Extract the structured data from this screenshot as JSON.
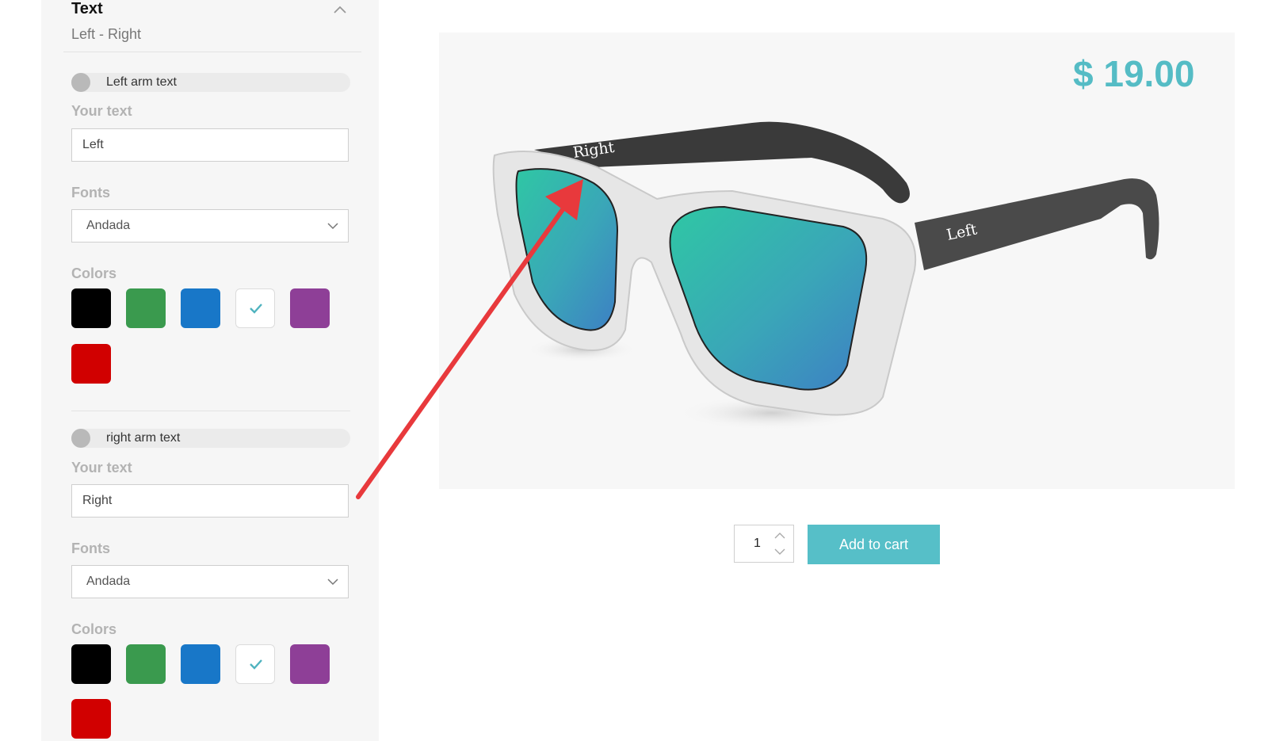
{
  "panel": {
    "title": "Text",
    "summary": "Left  - Right"
  },
  "sections": [
    {
      "toggle_label": "Left arm text",
      "text_label": "Your text",
      "text_value": "Left",
      "fonts_label": "Fonts",
      "font_value": "Andada",
      "colors_label": "Colors",
      "selected_color": "#ffffff"
    },
    {
      "toggle_label": "right arm text",
      "text_label": "Your text",
      "text_value": "Right",
      "fonts_label": "Fonts",
      "font_value": "Andada",
      "colors_label": "Colors",
      "selected_color": "#ffffff"
    }
  ],
  "swatch_colors": [
    "#000000",
    "#3a9a4e",
    "#1877c8",
    "#ffffff",
    "#8e3f97",
    "#d10000"
  ],
  "product": {
    "price": "$ 19.00",
    "quantity": "1",
    "add_to_cart": "Add to cart",
    "engraving_temple_back": "Right",
    "engraving_temple_front": "Left",
    "accent_color": "#56bfc8",
    "annotation_arrow_color": "#e8393c"
  }
}
